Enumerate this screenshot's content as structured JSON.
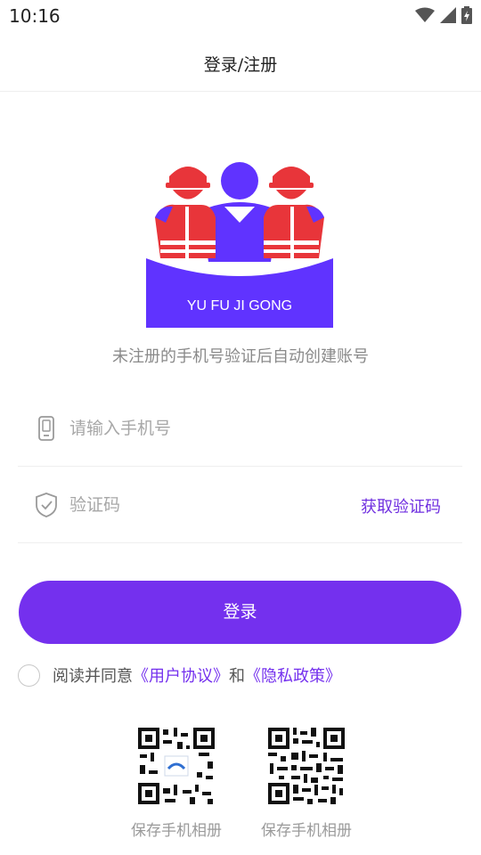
{
  "status_bar": {
    "time": "10:16"
  },
  "header": {
    "title": "登录/注册"
  },
  "logo": {
    "text": "YU FU JI GONG",
    "brand_color": "#6033ff",
    "accent_color": "#e8353a"
  },
  "hint": "未注册的手机号验证后自动创建账号",
  "phone": {
    "placeholder": "请输入手机号",
    "value": ""
  },
  "code": {
    "placeholder": "验证码",
    "value": "",
    "get_code_label": "获取验证码"
  },
  "login_button": "登录",
  "agreement": {
    "prefix": "阅读并同意",
    "user_agreement": "《用户协议》",
    "and": "和",
    "privacy_policy": "《隐私政策》",
    "checked": false
  },
  "qr_codes": [
    {
      "caption": "保存手机相册"
    },
    {
      "caption": "保存手机相册"
    }
  ],
  "colors": {
    "accent": "#7430ee",
    "hint_text": "#8a8a8a"
  }
}
